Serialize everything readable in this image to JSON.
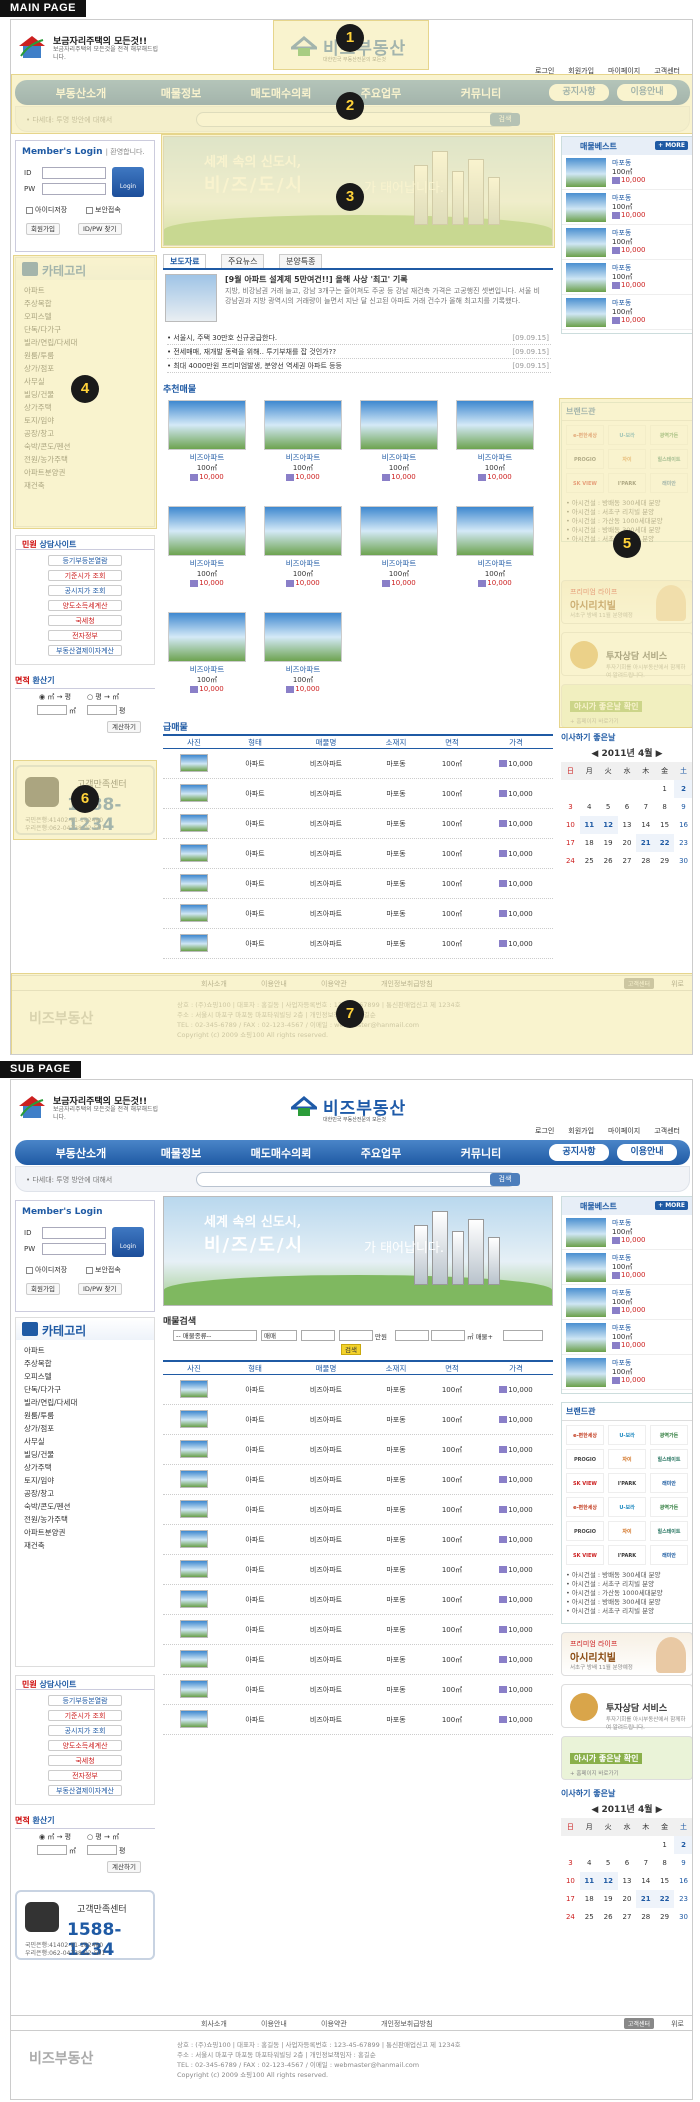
{
  "labels": {
    "main": "MAIN PAGE",
    "sub": "SUB PAGE"
  },
  "header": {
    "left_title": "보금자리주택의 모든것!!",
    "left_sub": "보금자리주택의 모든것을 전격 해부해드립니다.",
    "brand": "비즈부동산",
    "brand_sub": "대한민국 부동산전문의 모든것",
    "top_links": [
      "로그인",
      "회원가입",
      "마이페이지",
      "고객센터"
    ]
  },
  "nav": {
    "items": [
      "부동산소개",
      "매물정보",
      "매도매수의뢰",
      "주요업무",
      "커뮤니티"
    ],
    "pills": [
      "공지사항",
      "이용안내"
    ],
    "subnav": "• 다세대: 투명 방안에 대해서",
    "search_btn": "검색"
  },
  "login": {
    "title": "Member's Login",
    "greet": "| 환영합니다.",
    "id": "ID",
    "pw": "PW",
    "btn": "Login",
    "save_id": "아이디저장",
    "secure": "보안접속",
    "join": "회원가입",
    "find": "ID/PW 찾기"
  },
  "category": {
    "title": "카테고리",
    "items": [
      "아파트",
      "주상복합",
      "오피스텔",
      "단독/다가구",
      "빌라/연립/다세대",
      "원룸/투룸",
      "상가/점포",
      "사무실",
      "빌딩/건물",
      "상가주택",
      "토지/임야",
      "공장/창고",
      "숙박/콘도/펜션",
      "전원/농가주택",
      "아파트분양권",
      "재건축"
    ]
  },
  "consult": {
    "title": "민원",
    "title2": " 상담사이트",
    "items": [
      "등기부등본열람",
      "기준시가 조회",
      "공시지가 조회",
      "양도소득세계산",
      "국세청",
      "전자정부",
      "부동산결제이자계산"
    ]
  },
  "area": {
    "title": "면적",
    "title2": " 환산기",
    "opt1": "㎡ → 평",
    "opt2": "평 → ㎡",
    "u1": "㎡",
    "u2": "평",
    "btn": "계산하기"
  },
  "cs": {
    "label": "고객만족센터",
    "tel": "1588-1234",
    "bank1": "국민은행:41402-01-102460",
    "bank2": "우리은행:062-04738-02-501"
  },
  "banner": {
    "line1": "세계 속의 신도시,",
    "line2": "비/즈/도/시",
    "line3": "가 태어납니다."
  },
  "best": {
    "title": "매물베스트",
    "more": "+ MORE",
    "items": [
      {
        "name": "마포동",
        "area": "100㎡",
        "price": "10,000"
      },
      {
        "name": "마포동",
        "area": "100㎡",
        "price": "10,000"
      },
      {
        "name": "마포동",
        "area": "100㎡",
        "price": "10,000"
      },
      {
        "name": "마포동",
        "area": "100㎡",
        "price": "10,000"
      },
      {
        "name": "마포동",
        "area": "100㎡",
        "price": "10,000"
      }
    ]
  },
  "brands": {
    "title": "브랜드관",
    "logos": [
      "e-편한세상",
      "U-보라",
      "광역가든",
      "PROGIO",
      "자이",
      "힐스테이트",
      "SK VIEW",
      "I'PARK",
      "래미안"
    ],
    "news": [
      "• 아시건설 : 방배동 300세대 분양",
      "• 아시건설 : 서초구 리치빌 분양",
      "• 아시건설 : 가산동 1000세대분양",
      "• 아시건설 : 방배동 300세대 분양",
      "• 아시건설 : 서초구 리치빌 분양"
    ]
  },
  "promos": [
    {
      "a": "프리미엄 라이프",
      "b": "아시리치빌",
      "c": "서초구 방배 11월 분양예정"
    },
    {
      "a": "",
      "b": "투자상담 서비스",
      "c": "투자기회를 아시부동산에서 함께하여 알려드립니다."
    },
    {
      "a": "",
      "b": "아시가 좋은날 확인",
      "c": "+ 홈페이지 바로가기"
    }
  ],
  "calendar": {
    "title": "이사하기 좋은날",
    "month": "2011년 4월",
    "days": [
      "日",
      "月",
      "火",
      "水",
      "木",
      "金",
      "土"
    ],
    "weeks": [
      [
        "",
        "",
        "",
        "",
        "",
        "1",
        "2"
      ],
      [
        "3",
        "4",
        "5",
        "6",
        "7",
        "8",
        "9"
      ],
      [
        "10",
        "11",
        "12",
        "13",
        "14",
        "15",
        "16"
      ],
      [
        "17",
        "18",
        "19",
        "20",
        "21",
        "22",
        "23"
      ],
      [
        "24",
        "25",
        "26",
        "27",
        "28",
        "29",
        "30"
      ]
    ]
  },
  "tabs": [
    "보도자료",
    "주요뉴스",
    "분양특종"
  ],
  "news": {
    "feat_title": "[9월 아파트 설계제 5만여건!!] 올해 사상 '최고' 기록",
    "feat_desc": "지방, 비강남권 거래 늘고, 강남 3개구는 줄어쳐도 주공 등 강남 재건축 가격은 고공행진 셋변입니다. 서울 비강남권과 지방 광역시의 거래량이 늘면서 지난 달 신고된 아파트 거래 건수가 올해 최고치를 기록했다.",
    "items": [
      {
        "t": "서울시, 주택 30만호 신규공급한다.",
        "d": "[09.09.15]"
      },
      {
        "t": "전세매매, 재개발 동력을 위해.. 투기부채를 잡 것인가??",
        "d": "[09.09.15]"
      },
      {
        "t": "최대 4000만원 프리미엄발생, 분양선 역세권 아파트 등등",
        "d": "[09.09.15]"
      }
    ]
  },
  "featured": {
    "title": "추천매물",
    "name": "비즈아파트",
    "area": "100㎡",
    "price": "10,000"
  },
  "urgent": {
    "title": "급매물",
    "cols": [
      "사진",
      "형태",
      "매물명",
      "소재지",
      "면적",
      "가격"
    ],
    "row": {
      "type": "아파트",
      "name": "비즈아파트",
      "loc": "마포동",
      "area": "100㎡",
      "price": "10,000"
    }
  },
  "search": {
    "title": "매물검색",
    "sel1": "-- 매물종류--",
    "sel2": "매매",
    "unit1": "만원",
    "unit2": "㎡ 매물+",
    "btn": "검색"
  },
  "footer": {
    "links": [
      "회사소개",
      "이용안내",
      "이용약관",
      "개인정보취급방침"
    ],
    "top": "고객센터",
    "top2": "위로",
    "logo": "비즈부동산",
    "l1": "상호 : (주)쇼핑100 | 대표자 : 홍길동 | 사업자등록번호 : 123-45-67899 | 통신판매업신고 제 1234호",
    "l2": "주소 : 서울시 마포구 마포동 마포타워빌딩 2층 | 개인정보책임자 : 홍길순",
    "l3": "TEL : 02-345-6789 / FAX : 02-123-4567 / 이메일 : webmaster@hanmail.com",
    "l4": "Copyright (c) 2009 쇼핑100 All rights reserved."
  },
  "badges": [
    "1",
    "2",
    "3",
    "4",
    "5",
    "6",
    "7"
  ]
}
